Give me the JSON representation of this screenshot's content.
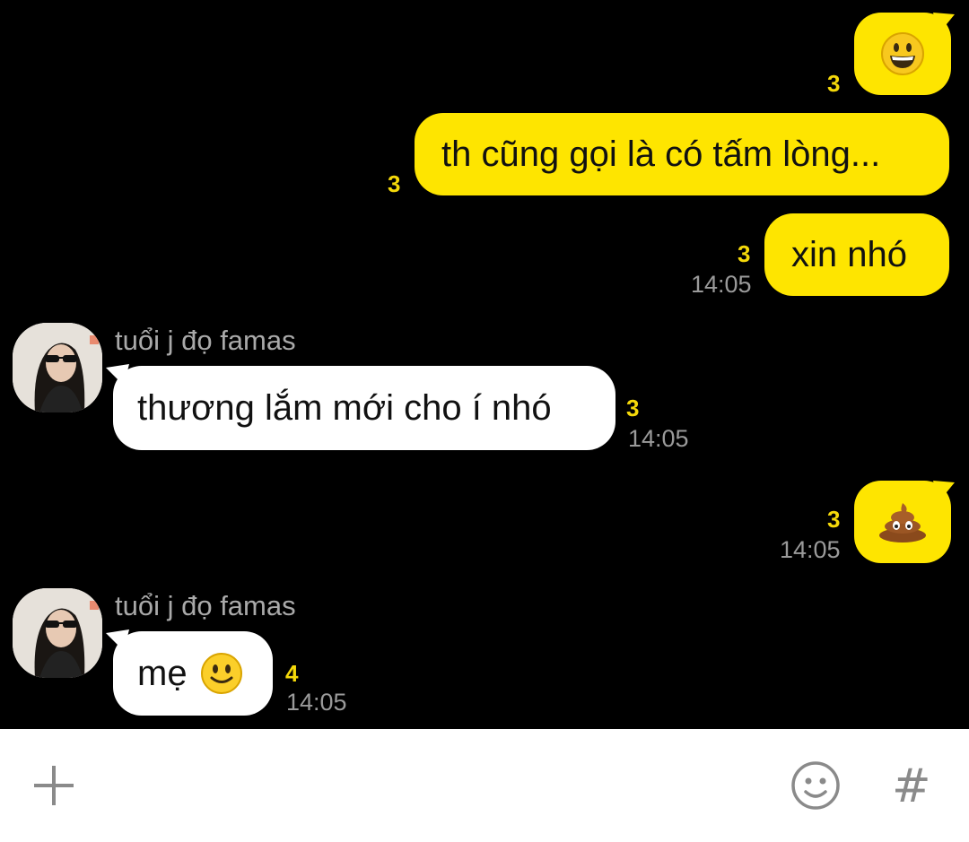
{
  "messages": [
    {
      "type": "outgoing-emoji",
      "emoji": "grinning-face",
      "read_count": "3"
    },
    {
      "type": "outgoing",
      "text": "th cũng gọi là có tấm lòng...",
      "read_count": "3"
    },
    {
      "type": "outgoing",
      "text": "xin nhó",
      "read_count": "3",
      "time": "14:05"
    },
    {
      "type": "incoming",
      "sender": "tuổi j đọ famas",
      "text": "thương lắm mới cho í nhó",
      "read_count": "3",
      "time": "14:05"
    },
    {
      "type": "outgoing-emoji",
      "emoji": "pile-of-poo",
      "read_count": "3",
      "time": "14:05"
    },
    {
      "type": "incoming",
      "sender": "tuổi j đọ famas",
      "text": "mẹ",
      "emoji": "smiling-face",
      "read_count": "4",
      "time": "14:05"
    }
  ],
  "input_bar": {
    "add_icon": "plus-icon",
    "emoticon_icon": "emoticon-icon",
    "hashtag_icon": "hashtag-icon",
    "hashtag_label": "#"
  },
  "colors": {
    "background": "#000000",
    "outgoing_bubble": "#fee500",
    "incoming_bubble": "#ffffff",
    "read_count": "#f5d90a",
    "timestamp": "#9a9a9a"
  }
}
